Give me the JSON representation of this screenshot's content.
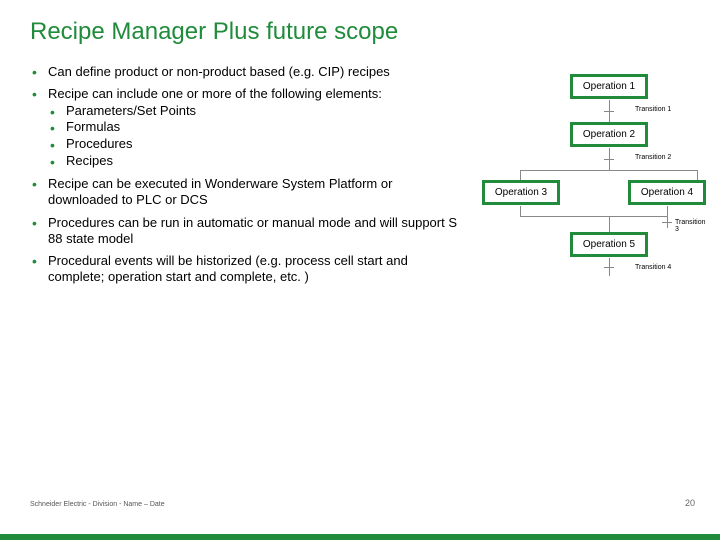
{
  "title": "Recipe Manager Plus future scope",
  "bullets": {
    "b1": "Can define product or non-product based (e.g. CIP) recipes",
    "b2": "Recipe can include one or more of the following elements:",
    "b2s": {
      "s1": "Parameters/Set Points",
      "s2": "Formulas",
      "s3": "Procedures",
      "s4": "Recipes"
    },
    "b3": "Recipe can be executed in Wonderware System Platform or downloaded to PLC or DCS",
    "b4": "Procedures can be run in automatic or manual mode and will support S 88 state model",
    "b5": "Procedural events will be historized (e.g. process cell start and complete; operation start and complete, etc. )"
  },
  "diagram": {
    "op1": "Operation 1",
    "t1": "Transition 1",
    "op2": "Operation 2",
    "t2": "Transition 2",
    "op3": "Operation 3",
    "op4": "Operation 4",
    "t3": "Transition 3",
    "op5": "Operation 5",
    "t4": "Transition 4"
  },
  "footer": "Schneider Electric - Division - Name – Date",
  "pagenum": "20"
}
